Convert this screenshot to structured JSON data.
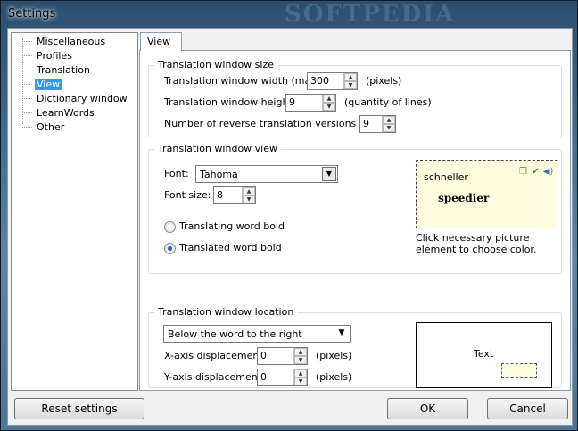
{
  "window": {
    "title": "Settings",
    "watermark": "SOFTPEDIA"
  },
  "tree": {
    "items": [
      "Miscellaneous",
      "Profiles",
      "Translation",
      "View",
      "Dictionary window",
      "LearnWords",
      "Other"
    ],
    "selected": "View"
  },
  "tab": {
    "label": "View"
  },
  "size_group": {
    "legend": "Translation window size",
    "width_label": "Translation window width (max):",
    "width_value": "300",
    "width_unit": "(pixels)",
    "height_label": "Translation window height:",
    "height_value": "9",
    "height_unit": "(quantity of lines)",
    "versions_label": "Number of reverse translation versions (max):",
    "versions_value": "9"
  },
  "view_group": {
    "legend": "Translation window view",
    "font_label": "Font:",
    "font_value": "Tahoma",
    "fontsize_label": "Font size:",
    "fontsize_value": "8",
    "radio_word_bold": "Translating word bold",
    "radio_translated_bold": "Translated word bold",
    "selected_radio": "Translated word bold",
    "preview_word": "schneller",
    "preview_translation": "speedier",
    "preview_icons": [
      "copy-icon",
      "check-icon",
      "speaker-icon"
    ],
    "hint": "Click necessary picture element to choose color."
  },
  "location_group": {
    "legend": "Translation window location",
    "location_value": "Below the word to the right",
    "x_label": "X-axis displacement:",
    "x_value": "0",
    "x_unit": "(pixels)",
    "y_label": "Y-axis displacement:",
    "y_value": "0",
    "y_unit": "(pixels)",
    "preview_text": "Text"
  },
  "buttons": {
    "reset": "Reset settings",
    "ok": "OK",
    "cancel": "Cancel"
  }
}
